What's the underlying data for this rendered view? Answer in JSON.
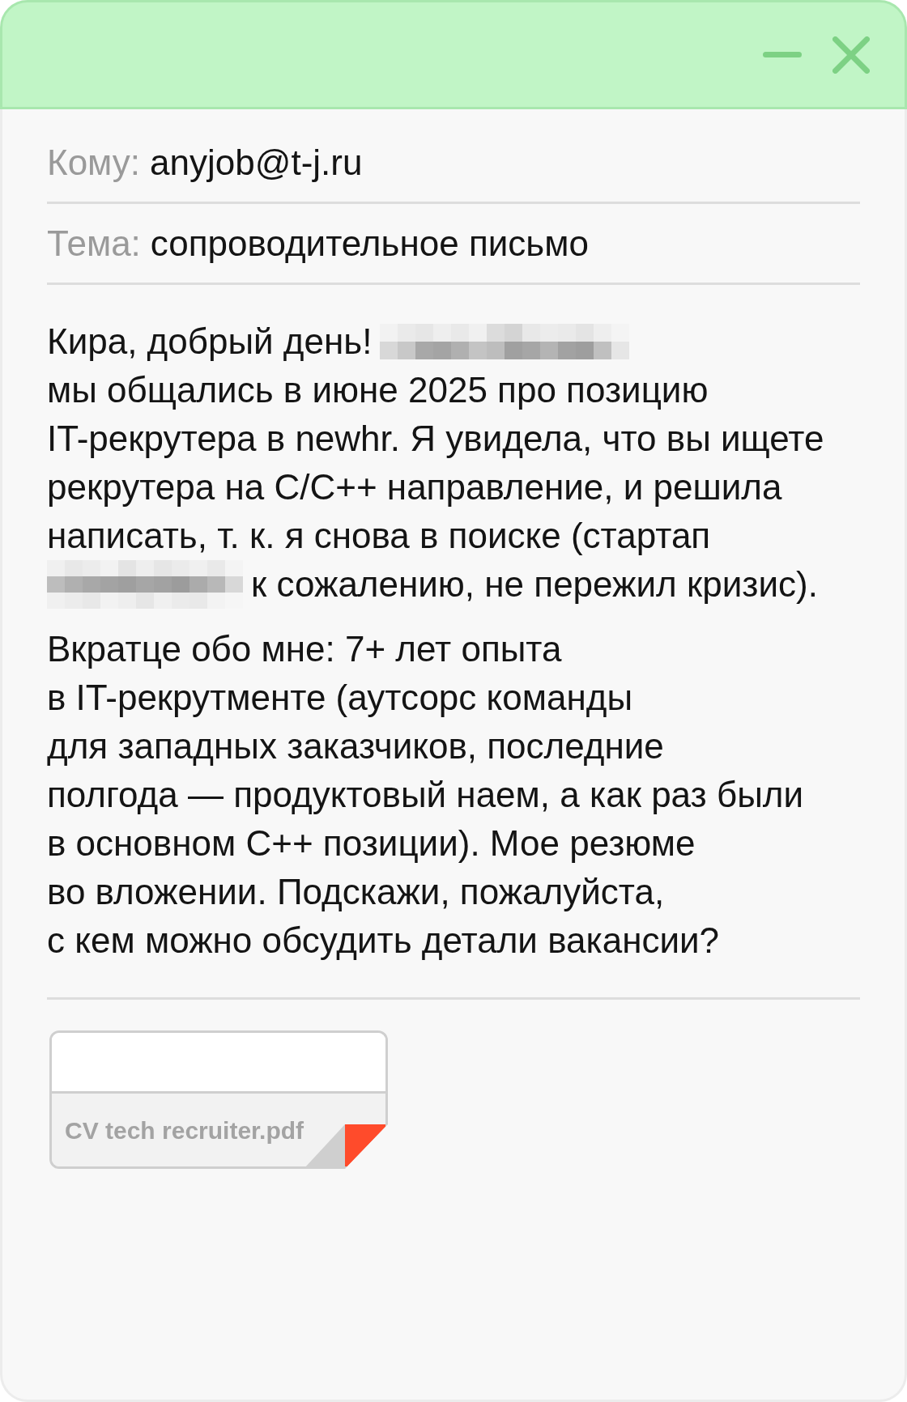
{
  "fields": [
    {
      "label": "Кому:",
      "value": "anyjob@t-j.ru"
    },
    {
      "label": "Тема:",
      "value": "сопроводительное письмо"
    }
  ],
  "message": {
    "paragraphs": [
      {
        "rows": [
          [
            {
              "kind": "text",
              "text": "Кира, добрый день!"
            },
            {
              "kind": "redacted"
            }
          ],
          [
            {
              "kind": "text",
              "text": "мы общались в июне 2025 про позицию\nIT-рекрутера в newhr. Я увидела, что вы ищете\nрекрутера на C/C++ направление, и решила\nнаписать, т. к. я снова в поиске (стартап"
            }
          ],
          [
            {
              "kind": "redacted"
            },
            {
              "kind": "text",
              "text": "к сожалению, не пережил кризис)."
            }
          ]
        ]
      },
      {
        "rows": [
          [
            {
              "kind": "text",
              "text": "Вкратце обо мне: 7+ лет опыта\nв IT-рекрутменте (аутсорс команды\nдля западных заказчиков, последние\nполгода — продуктовый наем, а как раз были\nв основном C++ позиции). Мое резюме\nво вложении. Подскажи, пожалуйста,\nс кем можно обсудить детали вакансии?"
            }
          ]
        ]
      }
    ]
  },
  "attachments": [
    {
      "filename": "CV tech recruiter.pdf"
    }
  ]
}
